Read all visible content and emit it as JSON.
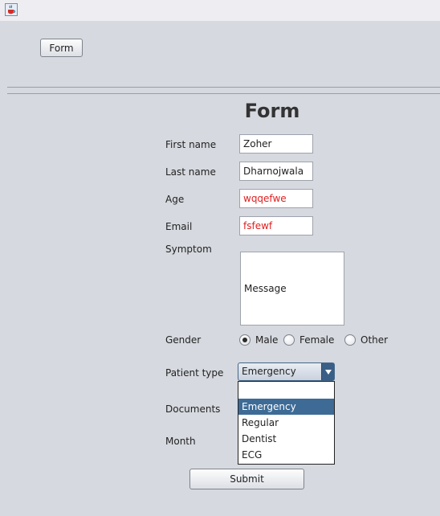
{
  "window": {
    "icon": "java-cup-icon"
  },
  "toolbar": {
    "form_button": "Form"
  },
  "page": {
    "title": "Form"
  },
  "fields": {
    "first_name": {
      "label": "First name",
      "value": "Zoher"
    },
    "last_name": {
      "label": "Last name",
      "value": "Dharnojwala"
    },
    "age": {
      "label": "Age",
      "value": "wqqefwe"
    },
    "email": {
      "label": "Email",
      "value": "fsfewf"
    },
    "symptom": {
      "label": "Symptom",
      "value": "Message"
    }
  },
  "gender": {
    "label": "Gender",
    "options": [
      "Male",
      "Female",
      "Other"
    ],
    "selected": "Male"
  },
  "patient_type": {
    "label": "Patient type",
    "value": "Emergency",
    "options": [
      "",
      "Emergency",
      "Regular",
      "Dentist",
      "ECG"
    ],
    "highlighted": "Emergency"
  },
  "documents": {
    "label": "Documents"
  },
  "month": {
    "label": "Month"
  },
  "submit": {
    "label": "Submit"
  },
  "colors": {
    "invalid_text": "#e02020",
    "selection": "#3d6b96",
    "background": "#d6d9df"
  }
}
